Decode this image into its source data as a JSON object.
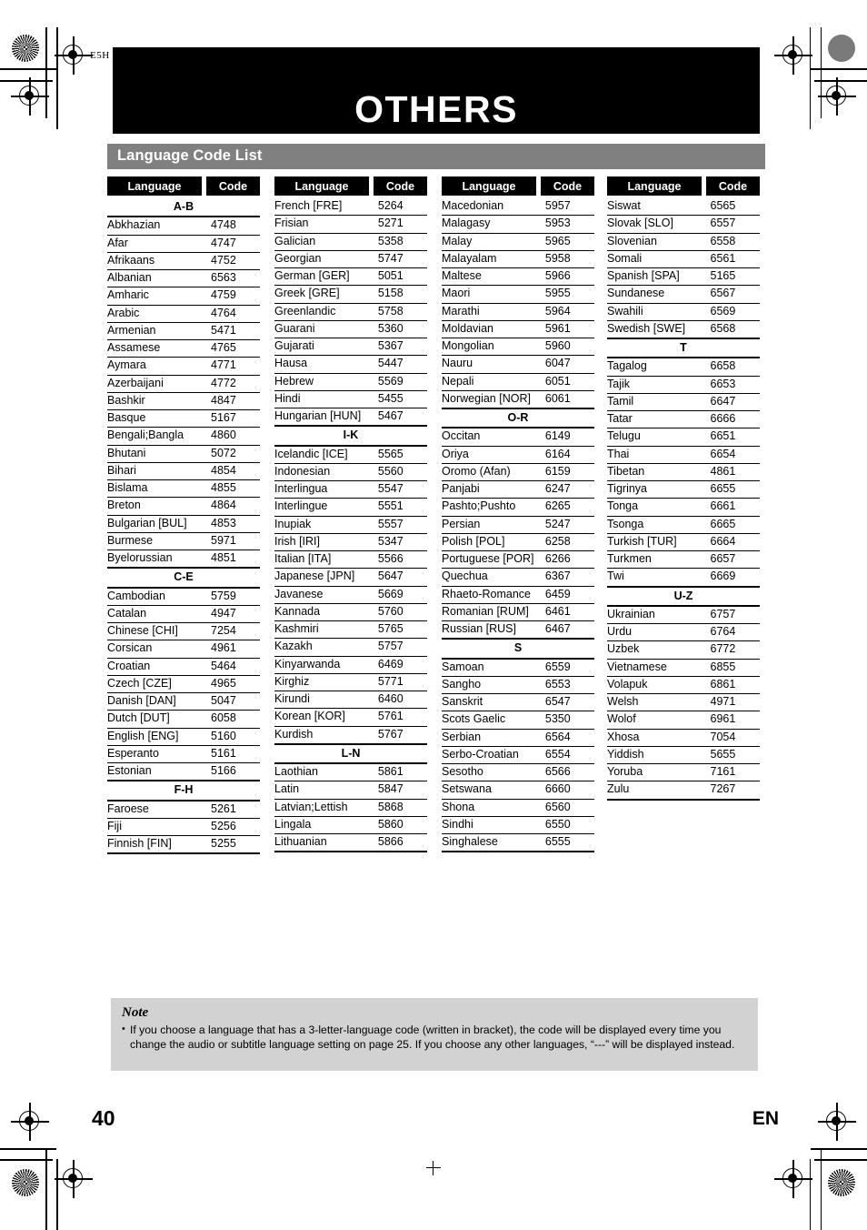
{
  "document": {
    "chapter_title": "OTHERS",
    "section_title": "Language Code List",
    "margin_code": "E5H",
    "page_number": "40",
    "page_language": "EN"
  },
  "table_headers": {
    "language": "Language",
    "code": "Code"
  },
  "columns": [
    {
      "id": "column-1",
      "groups": [
        {
          "heading": "A-B",
          "rows": [
            {
              "language": "Abkhazian",
              "code": "4748"
            },
            {
              "language": "Afar",
              "code": "4747"
            },
            {
              "language": "Afrikaans",
              "code": "4752"
            },
            {
              "language": "Albanian",
              "code": "6563"
            },
            {
              "language": "Amharic",
              "code": "4759"
            },
            {
              "language": "Arabic",
              "code": "4764"
            },
            {
              "language": "Armenian",
              "code": "5471"
            },
            {
              "language": "Assamese",
              "code": "4765"
            },
            {
              "language": "Aymara",
              "code": "4771"
            },
            {
              "language": "Azerbaijani",
              "code": "4772"
            },
            {
              "language": "Bashkir",
              "code": "4847"
            },
            {
              "language": "Basque",
              "code": "5167"
            },
            {
              "language": "Bengali;Bangla",
              "code": "4860"
            },
            {
              "language": "Bhutani",
              "code": "5072"
            },
            {
              "language": "Bihari",
              "code": "4854"
            },
            {
              "language": "Bislama",
              "code": "4855"
            },
            {
              "language": "Breton",
              "code": "4864"
            },
            {
              "language": "Bulgarian [BUL]",
              "code": "4853"
            },
            {
              "language": "Burmese",
              "code": "5971"
            },
            {
              "language": "Byelorussian",
              "code": "4851"
            }
          ]
        },
        {
          "heading": "C-E",
          "rows": [
            {
              "language": "Cambodian",
              "code": "5759"
            },
            {
              "language": "Catalan",
              "code": "4947"
            },
            {
              "language": "Chinese [CHI]",
              "code": "7254"
            },
            {
              "language": "Corsican",
              "code": "4961"
            },
            {
              "language": "Croatian",
              "code": "5464"
            },
            {
              "language": "Czech [CZE]",
              "code": "4965"
            },
            {
              "language": "Danish [DAN]",
              "code": "5047"
            },
            {
              "language": "Dutch [DUT]",
              "code": "6058"
            },
            {
              "language": "English [ENG]",
              "code": "5160"
            },
            {
              "language": "Esperanto",
              "code": "5161"
            },
            {
              "language": "Estonian",
              "code": "5166"
            }
          ]
        },
        {
          "heading": "F-H",
          "rows": [
            {
              "language": "Faroese",
              "code": "5261"
            },
            {
              "language": "Fiji",
              "code": "5256"
            },
            {
              "language": "Finnish [FIN]",
              "code": "5255"
            }
          ]
        }
      ]
    },
    {
      "id": "column-2",
      "groups": [
        {
          "heading": "",
          "rows": [
            {
              "language": "French [FRE]",
              "code": "5264"
            },
            {
              "language": "Frisian",
              "code": "5271"
            },
            {
              "language": "Galician",
              "code": "5358"
            },
            {
              "language": "Georgian",
              "code": "5747"
            },
            {
              "language": "German [GER]",
              "code": "5051"
            },
            {
              "language": "Greek [GRE]",
              "code": "5158"
            },
            {
              "language": "Greenlandic",
              "code": "5758"
            },
            {
              "language": "Guarani",
              "code": "5360"
            },
            {
              "language": "Gujarati",
              "code": "5367"
            },
            {
              "language": "Hausa",
              "code": "5447"
            },
            {
              "language": "Hebrew",
              "code": "5569"
            },
            {
              "language": "Hindi",
              "code": "5455"
            },
            {
              "language": "Hungarian [HUN]",
              "code": "5467"
            }
          ]
        },
        {
          "heading": "I-K",
          "rows": [
            {
              "language": "Icelandic [ICE]",
              "code": "5565"
            },
            {
              "language": "Indonesian",
              "code": "5560"
            },
            {
              "language": "Interlingua",
              "code": "5547"
            },
            {
              "language": "Interlingue",
              "code": "5551"
            },
            {
              "language": "Inupiak",
              "code": "5557"
            },
            {
              "language": "Irish [IRI]",
              "code": "5347"
            },
            {
              "language": "Italian [ITA]",
              "code": "5566"
            },
            {
              "language": "Japanese [JPN]",
              "code": "5647"
            },
            {
              "language": "Javanese",
              "code": "5669"
            },
            {
              "language": "Kannada",
              "code": "5760"
            },
            {
              "language": "Kashmiri",
              "code": "5765"
            },
            {
              "language": "Kazakh",
              "code": "5757"
            },
            {
              "language": "Kinyarwanda",
              "code": "6469"
            },
            {
              "language": "Kirghiz",
              "code": "5771"
            },
            {
              "language": "Kirundi",
              "code": "6460"
            },
            {
              "language": "Korean [KOR]",
              "code": "5761"
            },
            {
              "language": "Kurdish",
              "code": "5767"
            }
          ]
        },
        {
          "heading": "L-N",
          "rows": [
            {
              "language": "Laothian",
              "code": "5861"
            },
            {
              "language": "Latin",
              "code": "5847"
            },
            {
              "language": "Latvian;Lettish",
              "code": "5868"
            },
            {
              "language": "Lingala",
              "code": "5860"
            },
            {
              "language": "Lithuanian",
              "code": "5866"
            }
          ]
        }
      ]
    },
    {
      "id": "column-3",
      "groups": [
        {
          "heading": "",
          "rows": [
            {
              "language": "Macedonian",
              "code": "5957"
            },
            {
              "language": "Malagasy",
              "code": "5953"
            },
            {
              "language": "Malay",
              "code": "5965"
            },
            {
              "language": "Malayalam",
              "code": "5958"
            },
            {
              "language": "Maltese",
              "code": "5966"
            },
            {
              "language": "Maori",
              "code": "5955"
            },
            {
              "language": "Marathi",
              "code": "5964"
            },
            {
              "language": "Moldavian",
              "code": "5961"
            },
            {
              "language": "Mongolian",
              "code": "5960"
            },
            {
              "language": "Nauru",
              "code": "6047"
            },
            {
              "language": "Nepali",
              "code": "6051"
            },
            {
              "language": "Norwegian [NOR]",
              "code": "6061"
            }
          ]
        },
        {
          "heading": "O-R",
          "rows": [
            {
              "language": "Occitan",
              "code": "6149"
            },
            {
              "language": "Oriya",
              "code": "6164"
            },
            {
              "language": "Oromo (Afan)",
              "code": "6159"
            },
            {
              "language": "Panjabi",
              "code": "6247"
            },
            {
              "language": "Pashto;Pushto",
              "code": "6265"
            },
            {
              "language": "Persian",
              "code": "5247"
            },
            {
              "language": "Polish [POL]",
              "code": "6258"
            },
            {
              "language": "Portuguese [POR]",
              "code": "6266"
            },
            {
              "language": "Quechua",
              "code": "6367"
            },
            {
              "language": "Rhaeto-Romance",
              "code": "6459"
            },
            {
              "language": "Romanian [RUM]",
              "code": "6461"
            },
            {
              "language": "Russian [RUS]",
              "code": "6467"
            }
          ]
        },
        {
          "heading": "S",
          "rows": [
            {
              "language": "Samoan",
              "code": "6559"
            },
            {
              "language": "Sangho",
              "code": "6553"
            },
            {
              "language": "Sanskrit",
              "code": "6547"
            },
            {
              "language": "Scots Gaelic",
              "code": "5350"
            },
            {
              "language": "Serbian",
              "code": "6564"
            },
            {
              "language": "Serbo-Croatian",
              "code": "6554"
            },
            {
              "language": "Sesotho",
              "code": "6566"
            },
            {
              "language": "Setswana",
              "code": "6660"
            },
            {
              "language": "Shona",
              "code": "6560"
            },
            {
              "language": "Sindhi",
              "code": "6550"
            },
            {
              "language": "Singhalese",
              "code": "6555"
            }
          ]
        }
      ]
    },
    {
      "id": "column-4",
      "groups": [
        {
          "heading": "",
          "rows": [
            {
              "language": "Siswat",
              "code": "6565"
            },
            {
              "language": "Slovak [SLO]",
              "code": "6557"
            },
            {
              "language": "Slovenian",
              "code": "6558"
            },
            {
              "language": "Somali",
              "code": "6561"
            },
            {
              "language": "Spanish [SPA]",
              "code": "5165"
            },
            {
              "language": "Sundanese",
              "code": "6567"
            },
            {
              "language": "Swahili",
              "code": "6569"
            },
            {
              "language": "Swedish [SWE]",
              "code": "6568"
            }
          ]
        },
        {
          "heading": "T",
          "rows": [
            {
              "language": "Tagalog",
              "code": "6658"
            },
            {
              "language": "Tajik",
              "code": "6653"
            },
            {
              "language": "Tamil",
              "code": "6647"
            },
            {
              "language": "Tatar",
              "code": "6666"
            },
            {
              "language": "Telugu",
              "code": "6651"
            },
            {
              "language": "Thai",
              "code": "6654"
            },
            {
              "language": "Tibetan",
              "code": "4861"
            },
            {
              "language": "Tigrinya",
              "code": "6655"
            },
            {
              "language": "Tonga",
              "code": "6661"
            },
            {
              "language": "Tsonga",
              "code": "6665"
            },
            {
              "language": "Turkish [TUR]",
              "code": "6664"
            },
            {
              "language": "Turkmen",
              "code": "6657"
            },
            {
              "language": "Twi",
              "code": "6669"
            }
          ]
        },
        {
          "heading": "U-Z",
          "rows": [
            {
              "language": "Ukrainian",
              "code": "6757"
            },
            {
              "language": "Urdu",
              "code": "6764"
            },
            {
              "language": "Uzbek",
              "code": "6772"
            },
            {
              "language": "Vietnamese",
              "code": "6855"
            },
            {
              "language": "Volapuk",
              "code": "6861"
            },
            {
              "language": "Welsh",
              "code": "4971"
            },
            {
              "language": "Wolof",
              "code": "6961"
            },
            {
              "language": "Xhosa",
              "code": "7054"
            },
            {
              "language": "Yiddish",
              "code": "5655"
            },
            {
              "language": "Yoruba",
              "code": "7161"
            },
            {
              "language": "Zulu",
              "code": "7267"
            }
          ]
        }
      ]
    }
  ],
  "note": {
    "title": "Note",
    "bullet": "•",
    "items": [
      "If you choose a language that has a 3-letter-language code (written in bracket), the code will be displayed every time you change the audio or subtitle language setting on page 25. If you choose any other languages, “---” will be displayed instead."
    ]
  },
  "colors": {
    "banner_black": "#000000",
    "section_gray": "#808080",
    "note_gray": "#d2d2d2"
  }
}
